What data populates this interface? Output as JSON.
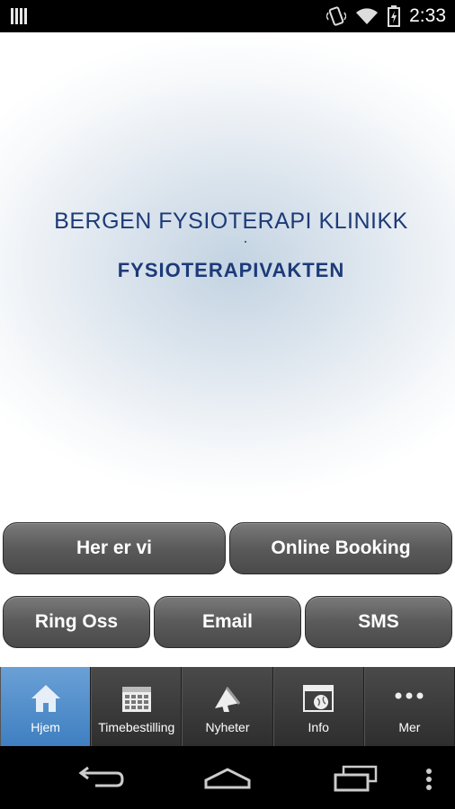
{
  "status_bar": {
    "time": "2:33"
  },
  "splash": {
    "title_line1": "BERGEN FYSIOTERAPI KLINIKK",
    "title_line2": "FYSIOTERAPIVAKTEN"
  },
  "buttons": {
    "her_er_vi": "Her er vi",
    "online_booking": "Online Booking",
    "ring_oss": "Ring Oss",
    "email": "Email",
    "sms": "SMS"
  },
  "tabs": [
    {
      "label": "Hjem",
      "icon": "home-icon",
      "active": true
    },
    {
      "label": "Timebestilling",
      "icon": "calendar-icon",
      "active": false
    },
    {
      "label": "Nyheter",
      "icon": "megaphone-icon",
      "active": false
    },
    {
      "label": "Info",
      "icon": "info-window-icon",
      "active": false
    },
    {
      "label": "Mer",
      "icon": "more-icon",
      "active": false
    }
  ],
  "colors": {
    "title": "#1d3a78",
    "active_tab": "#4f8ccb",
    "button": "#5a5a5a"
  }
}
